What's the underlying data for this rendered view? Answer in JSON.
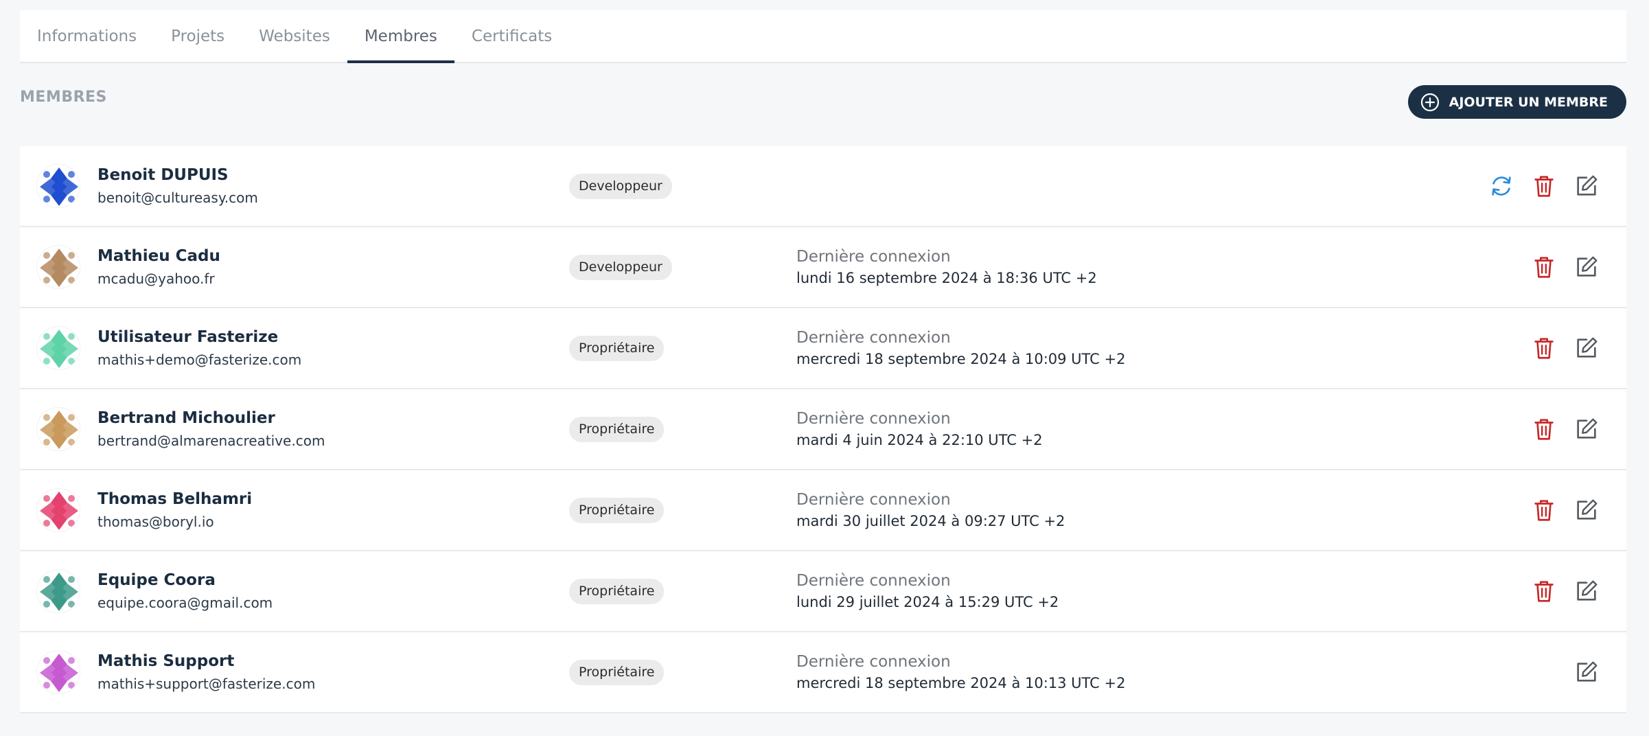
{
  "tabs": [
    {
      "label": "Informations"
    },
    {
      "label": "Projets"
    },
    {
      "label": "Websites"
    },
    {
      "label": "Membres"
    },
    {
      "label": "Certificats"
    }
  ],
  "section": {
    "title": "MEMBRES",
    "add_label": "AJOUTER UN MEMBRE"
  },
  "members": [
    {
      "name": "Benoit DUPUIS",
      "email": "benoit@cultureasy.com",
      "role": "Developpeur",
      "conn_label": "",
      "conn_date": "",
      "avatar_color": "#1f4fd0"
    },
    {
      "name": "Mathieu Cadu",
      "email": "mcadu@yahoo.fr",
      "role": "Developpeur",
      "conn_label": "Dernière connexion",
      "conn_date": "lundi 16 septembre 2024 à 18:36 UTC +2",
      "avatar_color": "#b48a60"
    },
    {
      "name": "Utilisateur Fasterize",
      "email": "mathis+demo@fasterize.com",
      "role": "Propriétaire",
      "conn_label": "Dernière connexion",
      "conn_date": "mercredi 18 septembre 2024 à 10:09 UTC +2",
      "avatar_color": "#5fd3a8"
    },
    {
      "name": "Bertrand Michoulier",
      "email": "bertrand@almarenacreative.com",
      "role": "Propriétaire",
      "conn_label": "Dernière connexion",
      "conn_date": "mardi 4 juin 2024 à 22:10 UTC +2",
      "avatar_color": "#c99a5c"
    },
    {
      "name": "Thomas Belhamri",
      "email": "thomas@boryl.io",
      "role": "Propriétaire",
      "conn_label": "Dernière connexion",
      "conn_date": "mardi 30 juillet 2024 à 09:27 UTC +2",
      "avatar_color": "#e5416f"
    },
    {
      "name": "Equipe Coora",
      "email": "equipe.coora@gmail.com",
      "role": "Propriétaire",
      "conn_label": "Dernière connexion",
      "conn_date": "lundi 29 juillet 2024 à 15:29 UTC +2",
      "avatar_color": "#3d9a8a"
    },
    {
      "name": "Mathis Support",
      "email": "mathis+support@fasterize.com",
      "role": "Propriétaire",
      "conn_label": "Dernière connexion",
      "conn_date": "mercredi 18 septembre 2024 à 10:13 UTC +2",
      "avatar_color": "#c65ad0"
    }
  ],
  "colors": {
    "accent": "#1b3045",
    "danger": "#c62828",
    "refresh": "#2a8bd8",
    "edit": "#555b61"
  }
}
